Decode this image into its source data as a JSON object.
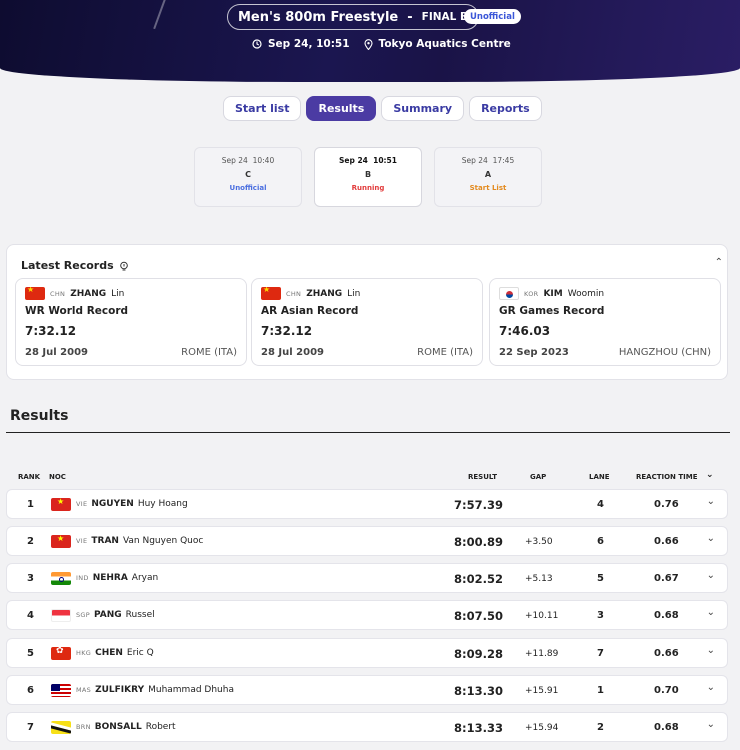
{
  "header": {
    "event_name": "Men's 800m Freestyle",
    "separator": "-",
    "phase": "FINAL B",
    "badge": "Unofficial",
    "date_time": "Sep 24, 10:51",
    "venue": "Tokyo Aquatics Centre"
  },
  "tabs": [
    {
      "label": "Start list",
      "active": false
    },
    {
      "label": "Results",
      "active": true
    },
    {
      "label": "Summary",
      "active": false
    },
    {
      "label": "Reports",
      "active": false
    }
  ],
  "heats": [
    {
      "date": "Sep 24",
      "time": "10:40",
      "label": "C",
      "status": "Unofficial",
      "status_color": "#4a6ee0"
    },
    {
      "date": "Sep 24",
      "time": "10:51",
      "label": "B",
      "status": "Running",
      "status_color": "#e23c3c"
    },
    {
      "date": "Sep 24",
      "time": "17:45",
      "label": "A",
      "status": "Start List",
      "status_color": "#e38a1e"
    }
  ],
  "records": {
    "title": "Latest Records",
    "items": [
      {
        "noc": "CHN",
        "family": "ZHANG",
        "given": "Lin",
        "type": "WR  World Record",
        "time": "7:32.12",
        "date": "28 Jul 2009",
        "venue": "ROME (ITA)",
        "flag": "chn"
      },
      {
        "noc": "CHN",
        "family": "ZHANG",
        "given": "Lin",
        "type": "AR  Asian Record",
        "time": "7:32.12",
        "date": "28 Jul 2009",
        "venue": "ROME (ITA)",
        "flag": "chn"
      },
      {
        "noc": "KOR",
        "family": "KIM",
        "given": "Woomin",
        "type": "GR  Games Record",
        "time": "7:46.03",
        "date": "22 Sep 2023",
        "venue": "HANGZHOU (CHN)",
        "flag": "kor"
      }
    ]
  },
  "results": {
    "title": "Results",
    "columns": {
      "rank": "RANK",
      "noc": "NOC",
      "result": "RESULT",
      "gap": "GAP",
      "lane": "LANE",
      "reaction": "REACTION TIME"
    },
    "rows": [
      {
        "rank": "1",
        "noc": "VIE",
        "family": "NGUYEN",
        "given": "Huy Hoang",
        "result": "7:57.39",
        "gap": "",
        "lane": "4",
        "reaction": "0.76",
        "flag": "vie"
      },
      {
        "rank": "2",
        "noc": "VIE",
        "family": "TRAN",
        "given": "Van Nguyen Quoc",
        "result": "8:00.89",
        "gap": "+3.50",
        "lane": "6",
        "reaction": "0.66",
        "flag": "vie"
      },
      {
        "rank": "3",
        "noc": "IND",
        "family": "NEHRA",
        "given": "Aryan",
        "result": "8:02.52",
        "gap": "+5.13",
        "lane": "5",
        "reaction": "0.67",
        "flag": "ind"
      },
      {
        "rank": "4",
        "noc": "SGP",
        "family": "PANG",
        "given": "Russel",
        "result": "8:07.50",
        "gap": "+10.11",
        "lane": "3",
        "reaction": "0.68",
        "flag": "sgp"
      },
      {
        "rank": "5",
        "noc": "HKG",
        "family": "CHEN",
        "given": "Eric Q",
        "result": "8:09.28",
        "gap": "+11.89",
        "lane": "7",
        "reaction": "0.66",
        "flag": "hkg"
      },
      {
        "rank": "6",
        "noc": "MAS",
        "family": "ZULFIKRY",
        "given": "Muhammad Dhuha",
        "result": "8:13.30",
        "gap": "+15.91",
        "lane": "1",
        "reaction": "0.70",
        "flag": "mas"
      },
      {
        "rank": "7",
        "noc": "BRN",
        "family": "BONSALL",
        "given": "Robert",
        "result": "8:13.33",
        "gap": "+15.94",
        "lane": "2",
        "reaction": "0.68",
        "flag": "brn"
      }
    ]
  },
  "icons": {
    "clock": "clock-icon",
    "location": "location-pin-icon",
    "info": "info-icon",
    "chevron": "chevron-down-icon",
    "collapse": "chevron-up-icon"
  }
}
